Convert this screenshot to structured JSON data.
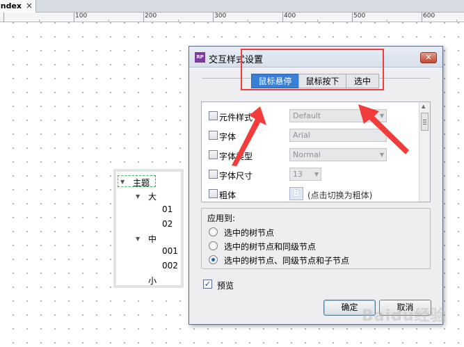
{
  "tab": {
    "title": "index",
    "close_glyph": "×"
  },
  "ruler": {
    "labels": [
      "100",
      "200",
      "300",
      "400",
      "500",
      "600"
    ]
  },
  "tree": {
    "nodes": [
      {
        "label": "主题",
        "expanded": true
      },
      {
        "label": "大",
        "expanded": true
      },
      {
        "label": "01"
      },
      {
        "label": "02"
      },
      {
        "label": "中",
        "expanded": true
      },
      {
        "label": "001"
      },
      {
        "label": "002"
      },
      {
        "label": "小"
      }
    ]
  },
  "dialog": {
    "title": "交互样式设置",
    "close_glyph": "✕",
    "tabs": [
      {
        "label": "鼠标悬停",
        "active": true
      },
      {
        "label": "鼠标按下",
        "active": false
      },
      {
        "label": "选中",
        "active": false
      }
    ],
    "properties": [
      {
        "label": "元件样式",
        "value": "Default",
        "checked": false
      },
      {
        "label": "字体",
        "value": "Arial",
        "checked": false
      },
      {
        "label": "字体类型",
        "value": "Normal",
        "checked": false
      },
      {
        "label": "字体尺寸",
        "value": "13",
        "checked": false
      },
      {
        "label": "粗体",
        "button": "B",
        "hint": "(点击切换为粗体)",
        "checked": false
      }
    ],
    "apply": {
      "title": "应用到:",
      "options": [
        {
          "label": "选中的树节点",
          "selected": false
        },
        {
          "label": "选中的树节点和同级节点",
          "selected": false
        },
        {
          "label": "选中的树节点、同级节点和子节点",
          "selected": true
        }
      ]
    },
    "preview": {
      "label": "预览",
      "checked": true
    },
    "buttons": {
      "ok": "确定",
      "cancel": "取消"
    }
  },
  "colors": {
    "annotation": "#f23c3c",
    "active_tab": "#3a7fd6",
    "tree_selection": "#3db24a"
  }
}
